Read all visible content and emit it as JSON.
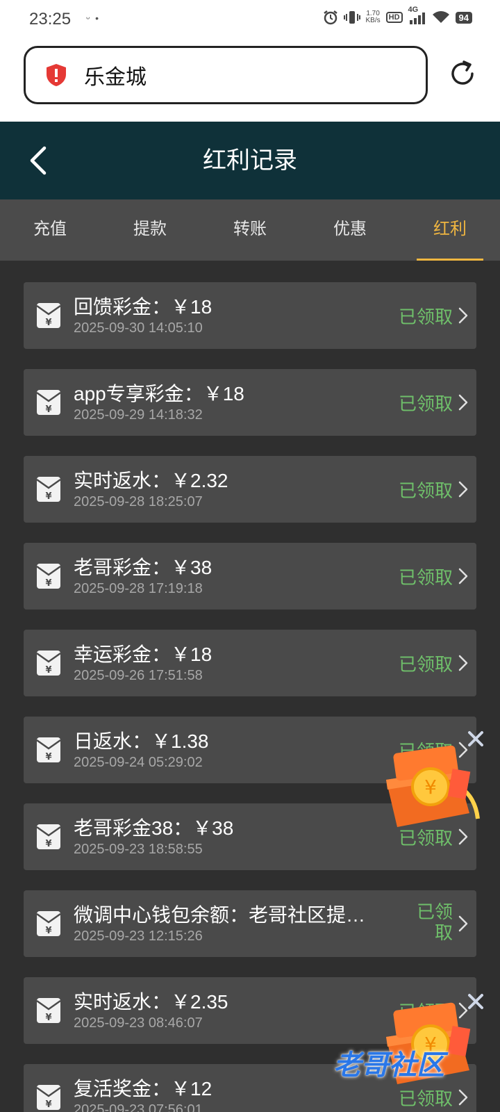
{
  "status_bar": {
    "time": "23:25",
    "notif": "ᵕ •",
    "speed_value": "1.70",
    "speed_unit": "KB/s",
    "hd": "HD",
    "network": "4G",
    "battery": "94"
  },
  "browser": {
    "url_title": "乐金城"
  },
  "header": {
    "title": "红利记录"
  },
  "tabs": [
    {
      "label": "充值"
    },
    {
      "label": "提款"
    },
    {
      "label": "转账"
    },
    {
      "label": "优惠"
    },
    {
      "label": "红利",
      "active": true
    }
  ],
  "records": [
    {
      "name": "回馈彩金：￥18",
      "date": "2025-09-30 14:05:10",
      "status": "已领取"
    },
    {
      "name": "app专享彩金：￥18",
      "date": "2025-09-29 14:18:32",
      "status": "已领取"
    },
    {
      "name": "实时返水：￥2.32",
      "date": "2025-09-28 18:25:07",
      "status": "已领取"
    },
    {
      "name": "老哥彩金：￥38",
      "date": "2025-09-28 17:19:18",
      "status": "已领取"
    },
    {
      "name": "幸运彩金：￥18",
      "date": "2025-09-26 17:51:58",
      "status": "已领取"
    },
    {
      "name": "日返水：￥1.38",
      "date": "2025-09-24 05:29:02",
      "status": "已领取"
    },
    {
      "name": "老哥彩金38：￥38",
      "date": "2025-09-23 18:58:55",
      "status": "已领取"
    },
    {
      "name": "微调中心钱包余额：老哥社区提…",
      "date": "2025-09-23 12:15:26",
      "status": "已领取"
    },
    {
      "name": "实时返水：￥2.35",
      "date": "2025-09-23 08:46:07",
      "status": "已领取"
    },
    {
      "name": "复活奖金：￥12",
      "date": "2025-09-23 07:56:01",
      "status": "已领取"
    }
  ],
  "watermark": "老哥社区",
  "colors": {
    "header_bg": "#0f3139",
    "tab_active": "#f0b640",
    "status_green": "#6fbf6a",
    "card_bg": "#4a4a4a"
  }
}
